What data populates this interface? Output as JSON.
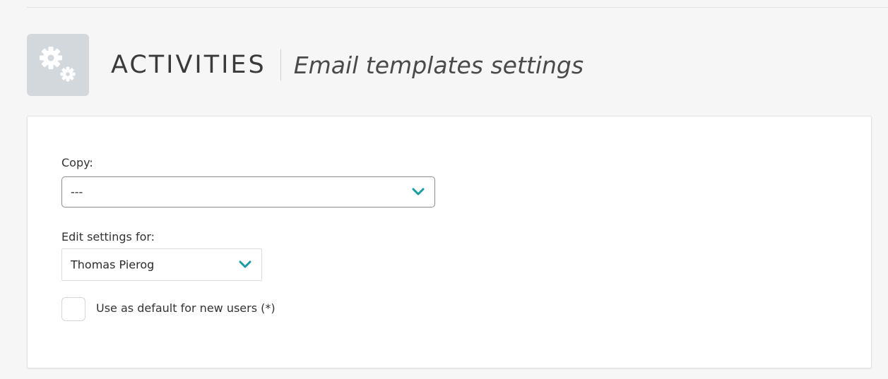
{
  "header": {
    "module_title": "ACTIVITIES",
    "page_subtitle": "Email templates settings",
    "icon": "gears-icon"
  },
  "form": {
    "copy": {
      "label": "Copy:",
      "selected_value": "---"
    },
    "edit_settings_for": {
      "label": "Edit settings for:",
      "selected_value": "Thomas Pierog"
    },
    "default_checkbox": {
      "label": "Use as default for new users (*)",
      "checked": false
    }
  },
  "colors": {
    "accent": "#1a9ba4",
    "icon_tile": "#d2d8dc",
    "page_background": "#f6f6f6"
  }
}
